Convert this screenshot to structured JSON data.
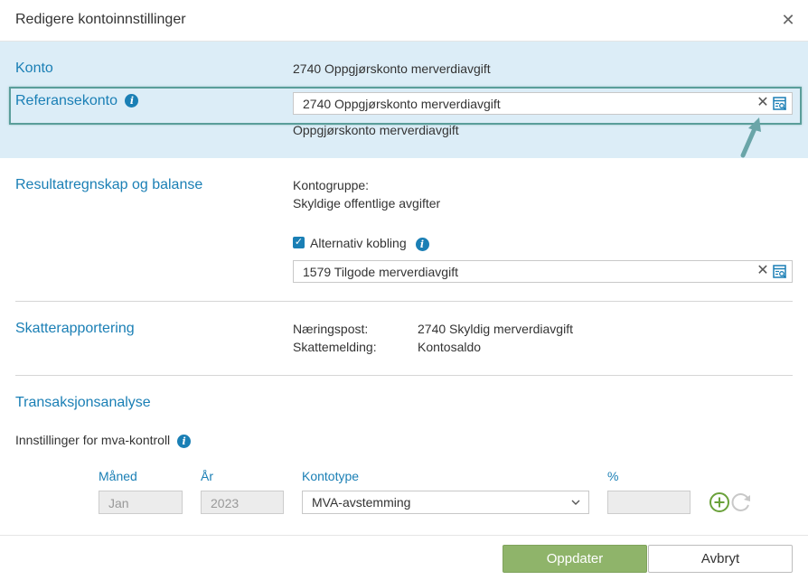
{
  "dialog": {
    "title": "Redigere kontoinnstillinger",
    "close_icon": "close-icon"
  },
  "konto": {
    "label": "Konto",
    "value": "2740 Oppgjørskonto merverdiavgift"
  },
  "referansekonto": {
    "label": "Referansekonto",
    "info_icon": "info-icon",
    "input_value": "2740 Oppgjørskonto merverdiavgift",
    "description": "Oppgjørskonto merverdiavgift",
    "highlight_color": "#5a9e9a"
  },
  "resultat": {
    "label": "Resultatregnskap og balanse",
    "kontogruppe_label": "Kontogruppe:",
    "kontogruppe_value": "Skyldige offentlige avgifter",
    "alternativ_checkbox_checked": true,
    "alternativ_label": "Alternativ kobling",
    "alternativ_value": "1579 Tilgode merverdiavgift"
  },
  "skatt": {
    "label": "Skatterapportering",
    "rows": [
      {
        "key": "Næringspost:",
        "value": "2740 Skyldig merverdiavgift"
      },
      {
        "key": "Skattemelding:",
        "value": "Kontosaldo"
      }
    ]
  },
  "transaksjon": {
    "label": "Transaksjonsanalyse",
    "mva_label": "Innstillinger for mva-kontroll",
    "columns": {
      "maaned": "Måned",
      "aar": "År",
      "kontotype": "Kontotype",
      "prosent": "%"
    },
    "maaned_value": "Jan",
    "aar_value": "2023",
    "kontotype_value": "MVA-avstemming",
    "prosent_value": ""
  },
  "footer": {
    "update_label": "Oppdater",
    "cancel_label": "Avbryt"
  },
  "colors": {
    "accent": "#1a7fb5",
    "band": "#dcedf7",
    "primary_button": "#8fb46a",
    "add_icon": "#6aa13a"
  }
}
